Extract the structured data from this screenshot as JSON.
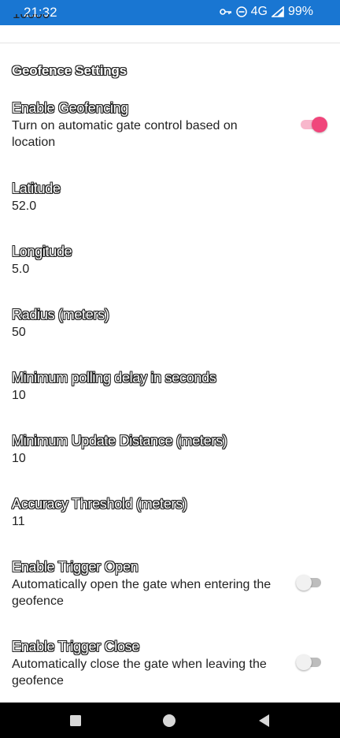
{
  "status_bar": {
    "time": "21:32",
    "network": "4G",
    "battery": "99%",
    "background": "#1976d2"
  },
  "cut_off_value": "10000",
  "section_header": "Geofence Settings",
  "preferences": {
    "enable_geofencing": {
      "title": "Enable Geofencing",
      "summary": "Turn on automatic gate control based on location",
      "checked": true
    },
    "latitude": {
      "title": "Latitude",
      "value": "52.0"
    },
    "longitude": {
      "title": "Longitude",
      "value": "5.0"
    },
    "radius": {
      "title": "Radius (meters)",
      "value": "50"
    },
    "polling_delay": {
      "title": "Minimum polling delay in seconds",
      "value": "10"
    },
    "update_distance": {
      "title": "Minimum Update Distance (meters)",
      "value": "10"
    },
    "accuracy_threshold": {
      "title": "Accuracy Threshold (meters)",
      "value": "11"
    },
    "trigger_open": {
      "title": "Enable Trigger Open",
      "summary": "Automatically open the gate when entering the geofence",
      "checked": false
    },
    "trigger_close": {
      "title": "Enable Trigger Close",
      "summary": "Automatically close the gate when leaving the geofence",
      "checked": false
    }
  },
  "colors": {
    "switch_on": "#f0467b",
    "switch_on_track": "#f8b7cc"
  },
  "nav_icons": [
    "recents-square-icon",
    "home-circle-icon",
    "back-triangle-icon"
  ]
}
